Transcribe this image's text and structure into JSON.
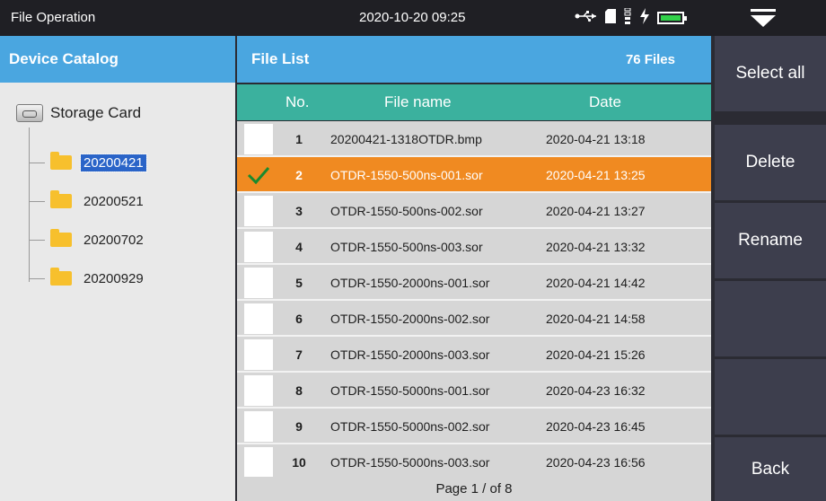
{
  "topbar": {
    "title": "File Operation",
    "datetime": "2020-10-20 09:25",
    "status_icons": [
      "usb-icon",
      "sd-card-icon",
      "signal-icon",
      "charging-icon",
      "battery-icon"
    ],
    "battery_color": "#32d14a"
  },
  "catalog": {
    "header": "Device Catalog",
    "root_label": "Storage Card",
    "folders": [
      {
        "label": "20200421",
        "selected": true
      },
      {
        "label": "20200521",
        "selected": false
      },
      {
        "label": "20200702",
        "selected": false
      },
      {
        "label": "20200929",
        "selected": false
      }
    ]
  },
  "filelist": {
    "header": "File List",
    "count": "76 Files",
    "columns": {
      "no": "No.",
      "name": "File name",
      "date": "Date"
    },
    "rows": [
      {
        "no": "1",
        "name": "20200421-1318OTDR.bmp",
        "date": "2020-04-21 13:18",
        "checked": false
      },
      {
        "no": "2",
        "name": "OTDR-1550-500ns-001.sor",
        "date": "2020-04-21 13:25",
        "checked": true
      },
      {
        "no": "3",
        "name": "OTDR-1550-500ns-002.sor",
        "date": "2020-04-21 13:27",
        "checked": false
      },
      {
        "no": "4",
        "name": "OTDR-1550-500ns-003.sor",
        "date": "2020-04-21 13:32",
        "checked": false
      },
      {
        "no": "5",
        "name": "OTDR-1550-2000ns-001.sor",
        "date": "2020-04-21 14:42",
        "checked": false
      },
      {
        "no": "6",
        "name": "OTDR-1550-2000ns-002.sor",
        "date": "2020-04-21 14:58",
        "checked": false
      },
      {
        "no": "7",
        "name": "OTDR-1550-2000ns-003.sor",
        "date": "2020-04-21 15:26",
        "checked": false
      },
      {
        "no": "8",
        "name": "OTDR-1550-5000ns-001.sor",
        "date": "2020-04-23 16:32",
        "checked": false
      },
      {
        "no": "9",
        "name": "OTDR-1550-5000ns-002.sor",
        "date": "2020-04-23 16:45",
        "checked": false
      },
      {
        "no": "10",
        "name": "OTDR-1550-5000ns-003.sor",
        "date": "2020-04-23 16:56",
        "checked": false
      }
    ],
    "pager": "Page 1 / of 8"
  },
  "actions": {
    "select_all": "Select all",
    "delete": "Delete",
    "rename": "Rename",
    "back": "Back"
  },
  "colors": {
    "accent_blue": "#4aa6e0",
    "header_teal": "#3bb19e",
    "selected_orange": "#f08a21",
    "side_button": "#3d3e4d"
  }
}
